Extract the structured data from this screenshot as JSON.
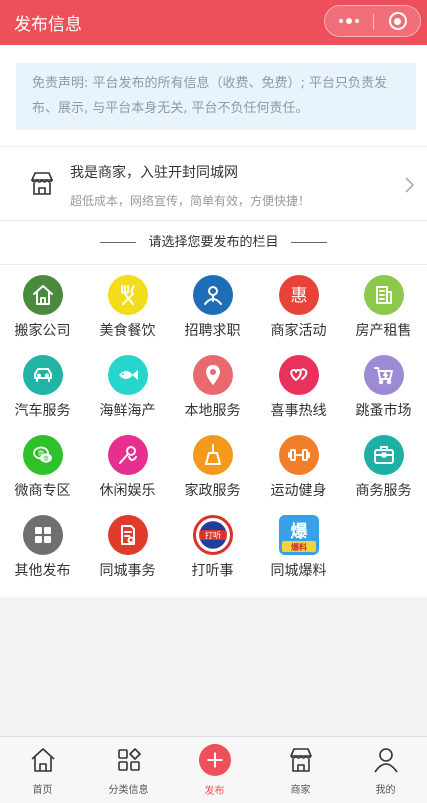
{
  "header": {
    "title": "发布信息"
  },
  "disclaimer": {
    "text": "免责声明: 平台发布的所有信息（收费、免费）; 平台只负责发布、展示, 与平台本身无关, 平台不负任何责任。"
  },
  "merchant": {
    "title": "我是商家，入驻开封同城网",
    "subtitle": "超低成本，网络宣传，简单有效，方便快捷！"
  },
  "section": {
    "title": "请选择您要发布的栏目"
  },
  "categories": [
    {
      "label": "搬家公司",
      "icon": "house-icon",
      "color": "#4a8a3c"
    },
    {
      "label": "美食餐饮",
      "icon": "fork-knife-icon",
      "color": "#f3dc1b"
    },
    {
      "label": "招聘求职",
      "icon": "person-icon",
      "color": "#1e6db6"
    },
    {
      "label": "商家活动",
      "icon": "hui-icon",
      "color": "#e8433a"
    },
    {
      "label": "房产租售",
      "icon": "building-icon",
      "color": "#8cc84b"
    },
    {
      "label": "汽车服务",
      "icon": "car-icon",
      "color": "#21b3a4"
    },
    {
      "label": "海鲜海产",
      "icon": "fish-icon",
      "color": "#28d5cc"
    },
    {
      "label": "本地服务",
      "icon": "location-pin-icon",
      "color": "#e86a6f"
    },
    {
      "label": "喜事热线",
      "icon": "hearts-icon",
      "color": "#e8325c"
    },
    {
      "label": "跳蚤市场",
      "icon": "cart-icon",
      "color": "#9c8ad4"
    },
    {
      "label": "微商专区",
      "icon": "wechat-icon",
      "color": "#2fc02a"
    },
    {
      "label": "休闲娱乐",
      "icon": "microphone-icon",
      "color": "#e62f8f"
    },
    {
      "label": "家政服务",
      "icon": "broom-icon",
      "color": "#f39a1d"
    },
    {
      "label": "运动健身",
      "icon": "dumbbell-icon",
      "color": "#f07e2a"
    },
    {
      "label": "商务服务",
      "icon": "briefcase-icon",
      "color": "#1fb0a5"
    },
    {
      "label": "其他发布",
      "icon": "grid-icon",
      "color": "#6f6f6f"
    },
    {
      "label": "同城事务",
      "icon": "document-icon",
      "color": "#e03a2b"
    },
    {
      "label": "打听事",
      "icon": "search-badge-icon",
      "color": "#d93227",
      "badge": "打听"
    },
    {
      "label": "同城爆料",
      "icon": "baoliao-icon",
      "color": "#38a0e8",
      "badge_top": "爆",
      "badge_bottom": "爆料"
    }
  ],
  "tabbar": [
    {
      "label": "首页",
      "icon": "home-icon",
      "active": false
    },
    {
      "label": "分类信息",
      "icon": "category-icon",
      "active": false
    },
    {
      "label": "发布",
      "icon": "plus-icon",
      "active": true
    },
    {
      "label": "商家",
      "icon": "shop-icon",
      "active": false
    },
    {
      "label": "我的",
      "icon": "user-icon",
      "active": false
    }
  ]
}
